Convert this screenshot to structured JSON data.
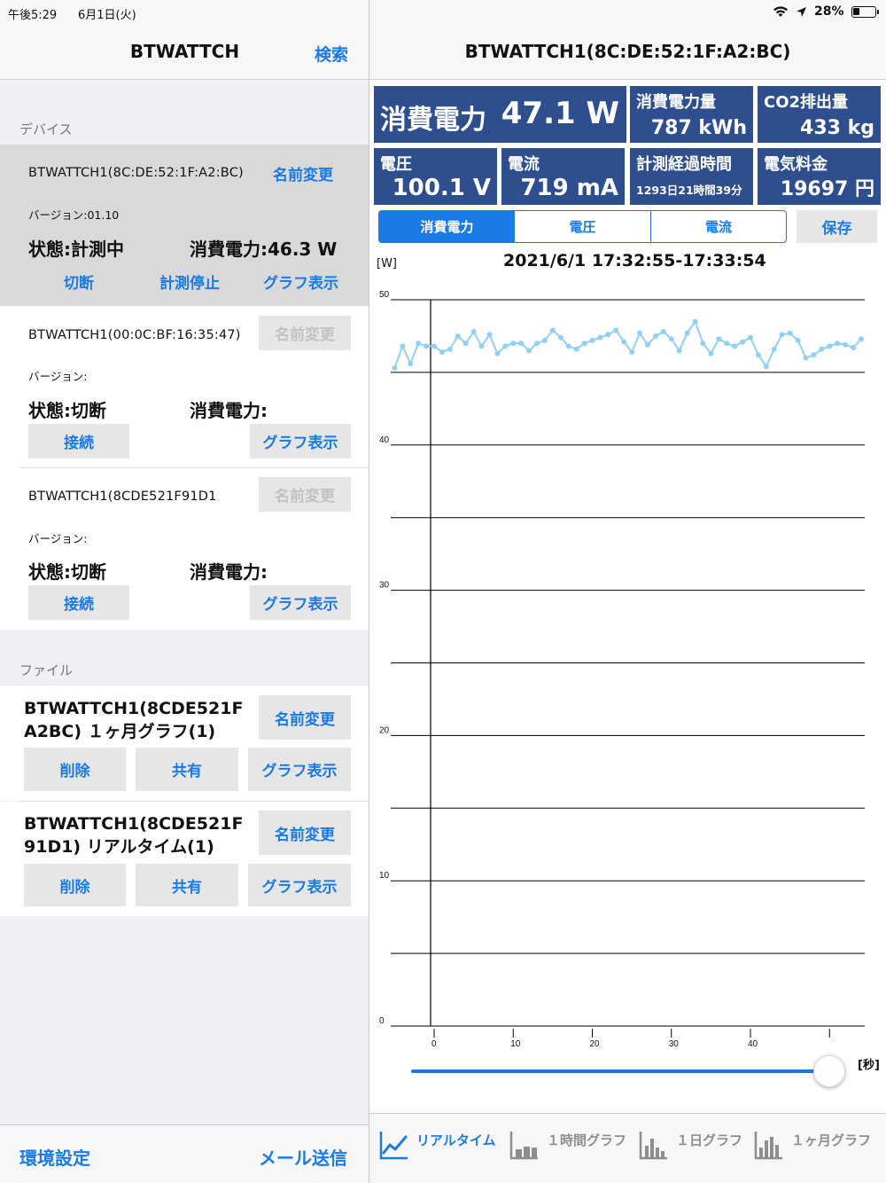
{
  "status_bar": {
    "time": "午後5:29",
    "date": "6月1日(火)",
    "battery": "28%"
  },
  "left": {
    "title": "BTWATTCH",
    "search": "検索",
    "devices_header": "デバイス",
    "devices": [
      {
        "name": "BTWATTCH1(8C:DE:52:1F:A2:BC)",
        "rename": "名前変更",
        "version": "バージョン:01.10",
        "state": "状態:計測中",
        "power": "消費電力:46.3 W",
        "left_action": "切断",
        "mid_action": "計測停止",
        "graph": "グラフ表示"
      },
      {
        "name": "BTWATTCH1(00:0C:BF:16:35:47)",
        "rename": "名前変更",
        "version": "バージョン:",
        "state": "状態:切断",
        "power": "消費電力:",
        "left_action": "接続",
        "graph": "グラフ表示"
      },
      {
        "name": "BTWATTCH1(8CDE521F91D1",
        "rename": "名前変更",
        "version": "バージョン:",
        "state": "状態:切断",
        "power": "消費電力:",
        "left_action": "接続",
        "graph": "グラフ表示"
      }
    ],
    "files_header": "ファイル",
    "files": [
      {
        "line1": "BTWATTCH1(8CDE521F",
        "line2": "A2BC) １ヶ月グラフ(1)",
        "rename": "名前変更",
        "delete": "削除",
        "share": "共有",
        "graph": "グラフ表示"
      },
      {
        "line1": "BTWATTCH1(8CDE521F",
        "line2": "91D1) リアルタイム(1)",
        "rename": "名前変更",
        "delete": "削除",
        "share": "共有",
        "graph": "グラフ表示"
      }
    ],
    "settings": "環境設定",
    "mail": "メール送信"
  },
  "right": {
    "title": "BTWATTCH1(8C:DE:52:1F:A2:BC)",
    "power_label": "消費電力",
    "power_value": "47.1 W",
    "energy_label": "消費電力量",
    "energy_value": "787 kWh",
    "co2_label": "CO2排出量",
    "co2_value": "433 kg",
    "voltage_label": "電圧",
    "voltage_value": "100.1 V",
    "current_label": "電流",
    "current_value": "719 mA",
    "elapsed_label": "計測経過時間",
    "elapsed_value": "1293日21時間39分",
    "cost_label": "電気料金",
    "cost_value": "19697 円",
    "segments": [
      "消費電力",
      "電圧",
      "電流"
    ],
    "save": "保存",
    "tabs": [
      "リアルタイム",
      "１時間グラフ",
      "１日グラフ",
      "１ヶ月グラフ"
    ]
  },
  "colors": {
    "tile": "#2e4e8e",
    "accent": "#1a7ae6",
    "series": "#8fd0f4"
  },
  "chart_data": {
    "type": "line",
    "title": "2021/6/1 17:32:55-17:33:54",
    "ylabel": "[W]",
    "xlabel": "[秒]",
    "ylim": [
      0,
      50
    ],
    "xlim": [
      -2,
      54
    ],
    "yticks": [
      0,
      10,
      20,
      30,
      40,
      50
    ],
    "xticks": [
      0,
      10,
      20,
      30,
      40
    ],
    "grid": true,
    "series": [
      {
        "x": [
          -5,
          -4,
          -3,
          -2,
          -1,
          0,
          1,
          2,
          3,
          4,
          5,
          6,
          7,
          8,
          9,
          10,
          11,
          12,
          13,
          14,
          15,
          16,
          17,
          18,
          19,
          20,
          21,
          22,
          23,
          24,
          25,
          26,
          27,
          28,
          29,
          30,
          31,
          32,
          33,
          34,
          35,
          36,
          37,
          38,
          39,
          40,
          41,
          42,
          43,
          44,
          45,
          46,
          47,
          48,
          49,
          50,
          51,
          52,
          53,
          54
        ],
        "y": [
          45.3,
          46.8,
          45.6,
          47.0,
          46.8,
          46.8,
          46.4,
          46.6,
          47.5,
          47.0,
          47.8,
          46.8,
          47.6,
          46.3,
          46.8,
          47.0,
          47.0,
          46.5,
          47.0,
          47.2,
          47.9,
          47.4,
          46.8,
          46.6,
          47.0,
          47.2,
          47.4,
          47.6,
          47.9,
          47.1,
          46.4,
          47.7,
          46.9,
          47.5,
          47.8,
          47.3,
          46.5,
          47.7,
          48.5,
          47.0,
          46.3,
          47.3,
          47.0,
          46.8,
          47.1,
          47.4,
          46.2,
          45.4,
          46.6,
          47.6,
          47.7,
          47.2,
          46.0,
          46.2,
          46.6,
          46.8,
          47.0,
          46.9,
          46.7,
          47.3
        ]
      }
    ]
  }
}
